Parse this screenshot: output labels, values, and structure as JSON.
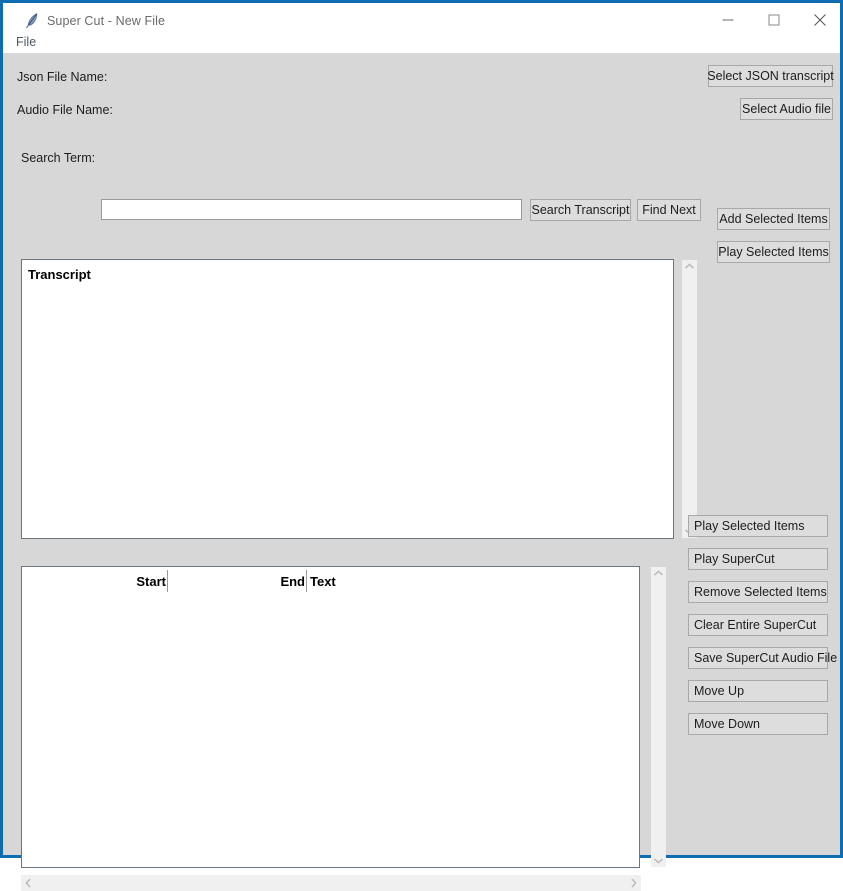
{
  "window": {
    "title": "Super Cut - New File",
    "icon": "feather-quill-icon",
    "accent_color": "#0f6cb0",
    "background_color": "#d7d7d7",
    "controls": {
      "minimize": "minimize-icon",
      "maximize": "maximize-icon",
      "close": "close-icon"
    }
  },
  "menubar": {
    "items": [
      {
        "label": "File"
      }
    ]
  },
  "file_section": {
    "json_label": "Json File Name:",
    "json_value": "",
    "json_button": "Select JSON transcript",
    "audio_label": "Audio File Name:",
    "audio_value": "",
    "audio_button": "Select Audio file"
  },
  "search_section": {
    "label": "Search Term:",
    "value": "",
    "placeholder": "",
    "search_button": "Search Transcript",
    "find_next_button": "Find Next"
  },
  "transcript_panel": {
    "heading": "Transcript",
    "rows": [],
    "buttons": [
      {
        "label": "Add Selected Items"
      },
      {
        "label": "Play Selected Items"
      }
    ]
  },
  "supercut_panel": {
    "columns": [
      "Start",
      "End",
      "Text"
    ],
    "rows": [],
    "buttons": [
      {
        "label": "Play Selected Items"
      },
      {
        "label": "Play SuperCut"
      },
      {
        "label": "Remove Selected Items"
      },
      {
        "label": "Clear Entire SuperCut"
      },
      {
        "label": "Save SuperCut Audio File"
      },
      {
        "label": "Move Up"
      },
      {
        "label": "Move Down"
      }
    ]
  },
  "scrollbars": {
    "up_arrow": "chevron-up-icon",
    "down_arrow": "chevron-down-icon",
    "left_arrow": "chevron-left-icon",
    "right_arrow": "chevron-right-icon"
  }
}
